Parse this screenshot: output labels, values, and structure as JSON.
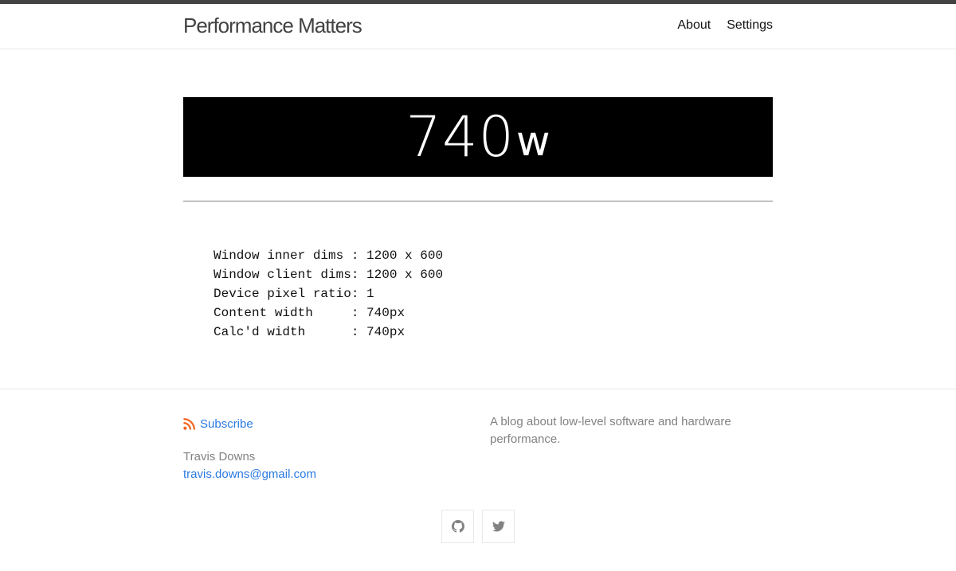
{
  "header": {
    "site_title": "Performance Matters",
    "nav": [
      {
        "label": "About"
      },
      {
        "label": "Settings"
      }
    ]
  },
  "banner": {
    "number": "740",
    "suffix": "w"
  },
  "dims_block": {
    "lines": [
      "Window inner dims : 1200 x 600",
      "Window client dims: 1200 x 600",
      "Device pixel ratio: 1",
      "Content width     : 740px",
      "Calc'd width      : 740px"
    ]
  },
  "footer": {
    "subscribe_label": "Subscribe",
    "author_name": "Travis Downs",
    "email": "travis.downs@gmail.com",
    "description": "A blog about low-level software and hardware performance.",
    "social": [
      {
        "icon": "github-icon"
      },
      {
        "icon": "twitter-icon"
      }
    ]
  },
  "colors": {
    "link": "#2a7ae2",
    "muted": "#828282",
    "top_rule": "#424242",
    "banner_bg": "#000000"
  }
}
